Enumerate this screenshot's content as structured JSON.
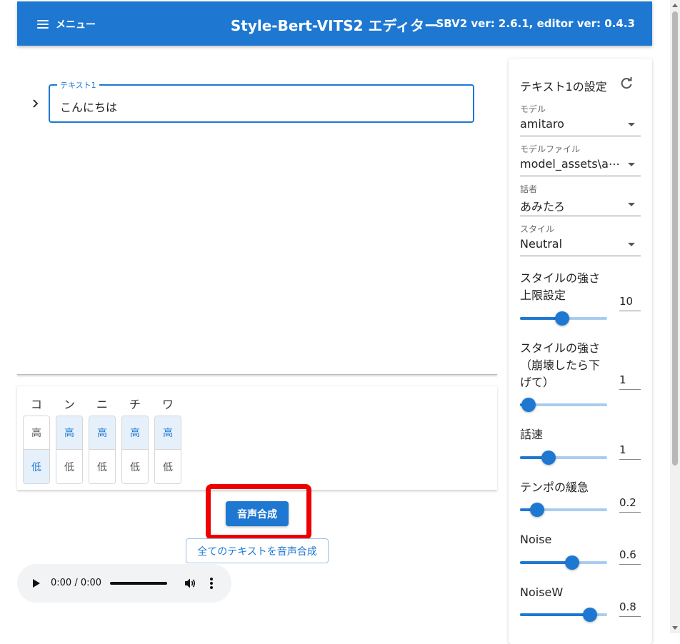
{
  "header": {
    "menu_label": "メニュー",
    "title": "Style-Bert-VITS2 エディター",
    "version": "SBV2 ver: 2.6.1, editor ver: 0.4.3",
    "color": "#1e78d2"
  },
  "editor": {
    "text_label": "テキスト1",
    "text_value": "こんにちは"
  },
  "accent": {
    "morae": [
      {
        "char": "コ",
        "high_label": "高",
        "low_label": "低",
        "selected": "low"
      },
      {
        "char": "ン",
        "high_label": "高",
        "low_label": "低",
        "selected": "high"
      },
      {
        "char": "ニ",
        "high_label": "高",
        "low_label": "低",
        "selected": "high"
      },
      {
        "char": "チ",
        "high_label": "高",
        "low_label": "低",
        "selected": "high"
      },
      {
        "char": "ワ",
        "high_label": "高",
        "low_label": "低",
        "selected": "high"
      }
    ]
  },
  "actions": {
    "synthesize_label": "音声合成",
    "synthesize_all_label": "全てのテキストを音声合成"
  },
  "audio": {
    "time": "0:00 / 0:00"
  },
  "settings": {
    "title": "テキスト1の設定",
    "selects": [
      {
        "label": "モデル",
        "value": "amitaro"
      },
      {
        "label": "モデルファイル",
        "value": "model_assets\\a⋯"
      },
      {
        "label": "話者",
        "value": "あみたろ"
      },
      {
        "label": "スタイル",
        "value": "Neutral"
      }
    ],
    "sliders": [
      {
        "label_lines": [
          "スタイルの強さ",
          "上限設定"
        ],
        "input_text": "10",
        "fraction": 0.48
      },
      {
        "label_lines": [
          "スタイルの強さ",
          "（崩壊したら下",
          "げて）"
        ],
        "input_text": "1",
        "fraction": 0.1
      },
      {
        "label_lines": [
          "話速"
        ],
        "input_text": "1",
        "fraction": 0.33
      },
      {
        "label_lines": [
          "テンポの緩急"
        ],
        "input_text": "0.2",
        "fraction": 0.2
      },
      {
        "label_lines": [
          "Noise"
        ],
        "input_text": "0.6",
        "fraction": 0.6
      },
      {
        "label_lines": [
          "NoiseW"
        ],
        "input_text": "0.8",
        "fraction": 0.8
      }
    ]
  }
}
